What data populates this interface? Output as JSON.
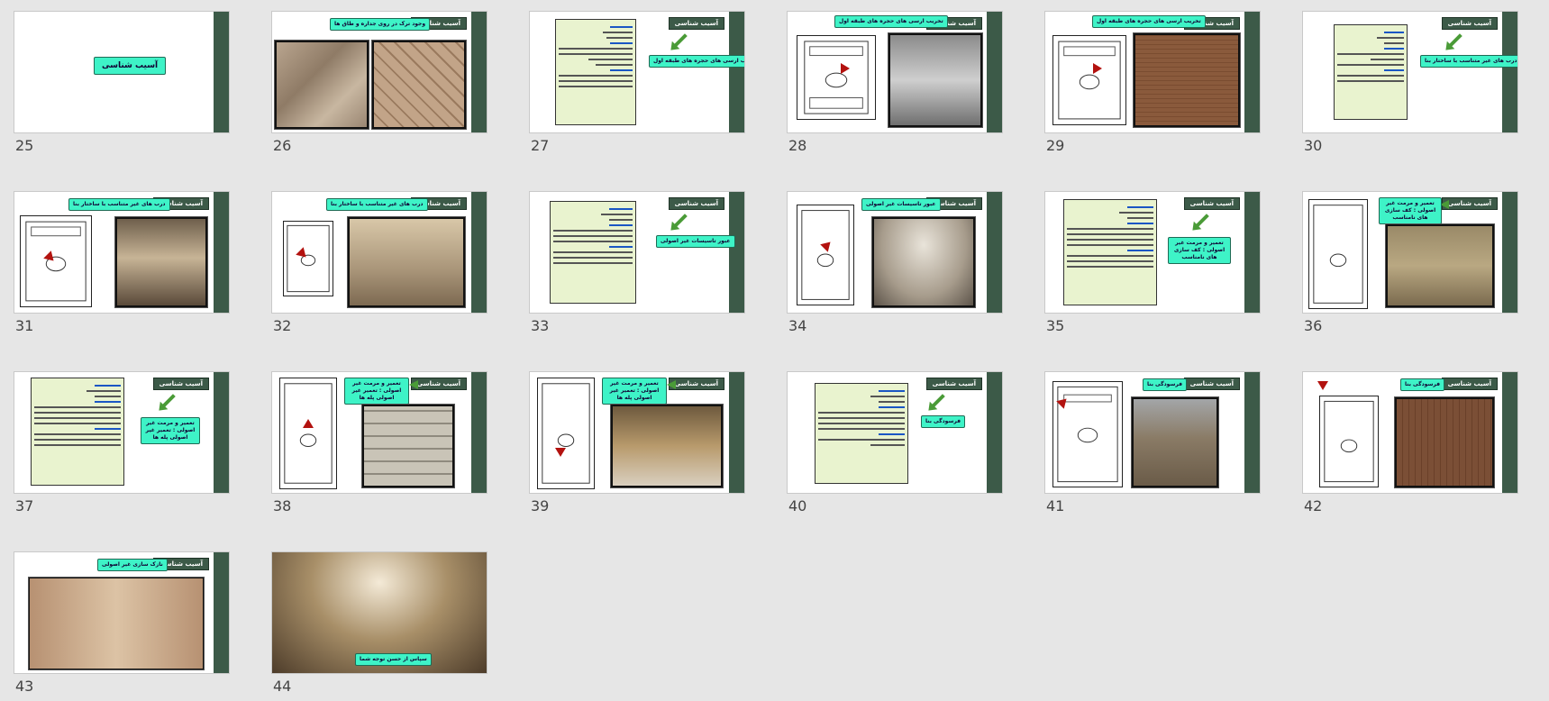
{
  "slides": [
    {
      "number": "25",
      "header": "",
      "callout": "آسیب شناسی"
    },
    {
      "number": "26",
      "header": "آسیب شناسی",
      "callout": "وجود ترک در روی جداره و طاق ها"
    },
    {
      "number": "27",
      "header": "آسیب شناسی",
      "callout": "تخریب ارسی های حجره های طبقه اول"
    },
    {
      "number": "28",
      "header": "آسیب شناسی",
      "callout": "تخریب ارسی های حجره های طبقه اول"
    },
    {
      "number": "29",
      "header": "آسیب شناسی",
      "callout": "تخریب ارسی های حجره های طبقه اول"
    },
    {
      "number": "30",
      "header": "آسیب شناسی",
      "callout": "درب های غیر متناسب با ساختار بنا"
    },
    {
      "number": "31",
      "header": "آسیب شناسی",
      "callout": "درب های غیر متناسب با ساختار بنا"
    },
    {
      "number": "32",
      "header": "آسیب شناسی",
      "callout": "درب های غیر متناسب با ساختار بنا"
    },
    {
      "number": "33",
      "header": "آسیب شناسی",
      "callout": "عبور تاسیسات غیر اصولی"
    },
    {
      "number": "34",
      "header": "آسیب شناسی",
      "callout": "عبور تاسیسات غیر اصولی"
    },
    {
      "number": "35",
      "header": "آسیب شناسی",
      "callout": "تعمیر و مرمت غیر اصولی : کف سازی های نامناسب"
    },
    {
      "number": "36",
      "header": "آسیب شناسی",
      "callout": "تعمیر و مرمت غیر اصولی : کف سازی های نامناسب"
    },
    {
      "number": "37",
      "header": "آسیب شناسی",
      "callout": "تعمیر و مرمت غیر اصولی : تعمیر غیر اصولی پله ها"
    },
    {
      "number": "38",
      "header": "آسیب شناسی",
      "callout": "تعمیر و مرمت غیر اصولی : تعمیر غیر اصولی پله ها"
    },
    {
      "number": "39",
      "header": "آسیب شناسی",
      "callout": "تعمیر و مرمت غیر اصولی : تعمیر غیر اصولی پله ها"
    },
    {
      "number": "40",
      "header": "آسیب شناسی",
      "callout": "فرسودگی بنا"
    },
    {
      "number": "41",
      "header": "آسیب شناسی",
      "callout": "فرسودگی بنا"
    },
    {
      "number": "42",
      "header": "آسیب شناسی",
      "callout": "فرسودگی بنا"
    },
    {
      "number": "43",
      "header": "آسیب شناسی",
      "callout": "نازک سازی غیر اصولی"
    },
    {
      "number": "44",
      "header": "",
      "callout": "سپاس از حسن توجه شما"
    }
  ],
  "colors": {
    "background": "#e6e6e6",
    "accent_bar": "#3c5a48",
    "callout": "#3ef3c7",
    "arrow": "#4a9b37",
    "textbox": "#e9f3cf"
  }
}
